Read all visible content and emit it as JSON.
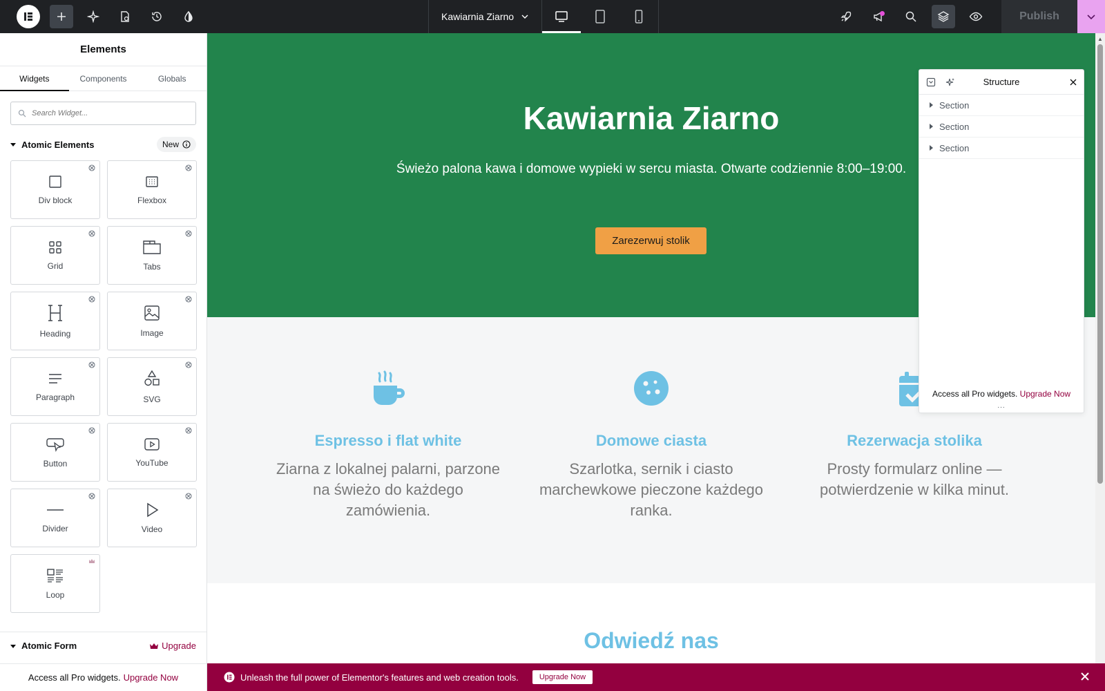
{
  "topbar": {
    "document_title": "Kawiarnia Ziarno",
    "publish_label": "Publish",
    "left_buttons": [
      "elementor-logo-icon",
      "add-element-icon",
      "site-settings-icon",
      "page-settings-icon",
      "history-icon",
      "theme-style-icon"
    ],
    "right_buttons": [
      "launch-icon",
      "whats-new-icon",
      "finder-icon",
      "structure-icon",
      "preview-icon"
    ]
  },
  "panel": {
    "title": "Elements",
    "tabs": [
      "Widgets",
      "Components",
      "Globals"
    ],
    "search_placeholder": "Search Widget...",
    "category": {
      "name": "Atomic Elements",
      "badge": "New"
    },
    "widgets": [
      {
        "label": "Div block",
        "icon": "div-block-icon"
      },
      {
        "label": "Flexbox",
        "icon": "flexbox-icon"
      },
      {
        "label": "Grid",
        "icon": "grid-icon"
      },
      {
        "label": "Tabs",
        "icon": "tabs-icon"
      },
      {
        "label": "Heading",
        "icon": "heading-icon"
      },
      {
        "label": "Image",
        "icon": "image-icon"
      },
      {
        "label": "Paragraph",
        "icon": "paragraph-icon"
      },
      {
        "label": "SVG",
        "icon": "svg-icon"
      },
      {
        "label": "Button",
        "icon": "button-icon"
      },
      {
        "label": "YouTube",
        "icon": "youtube-icon"
      },
      {
        "label": "Divider",
        "icon": "divider-icon"
      },
      {
        "label": "Video",
        "icon": "video-icon"
      },
      {
        "label": "Loop",
        "icon": "loop-icon"
      }
    ],
    "form_category": {
      "name": "Atomic Form",
      "upgrade": "Upgrade"
    },
    "footer": {
      "text": "Access all Pro widgets.",
      "link": "Upgrade Now"
    }
  },
  "canvas": {
    "hero": {
      "title": "Kawiarnia Ziarno",
      "subtitle": "Świeżo palona kawa i domowe wypieki w sercu miasta. Otwarte codziennie 8:00–19:00.",
      "button": "Zarezerwuj stolik"
    },
    "features": [
      {
        "icon": "coffee-cup-icon",
        "title": "Espresso i flat white",
        "text": "Ziarna z lokalnej palarni, parzone na świeżo do każdego zamówienia."
      },
      {
        "icon": "cookie-icon",
        "title": "Domowe ciasta",
        "text": "Szarlotka, sernik i ciasto marchewkowe pieczone każdego ranka."
      },
      {
        "icon": "calendar-check-icon",
        "title": "Rezerwacja stolika",
        "text": "Prosty formularz online — potwierdzenie w kilka minut."
      }
    ],
    "visit_title": "Odwiedź nas"
  },
  "structure": {
    "title": "Structure",
    "items": [
      "Section",
      "Section",
      "Section"
    ],
    "footer_text": "Access all Pro widgets.",
    "footer_link": "Upgrade Now",
    "more": "..."
  },
  "banner": {
    "text": "Unleash the full power of Elementor's features and web creation tools.",
    "button": "Upgrade Now"
  },
  "colors": {
    "topbar": "#1f2124",
    "hero": "#22844c",
    "accent": "#6ec1e4",
    "cta": "#f0a045",
    "pro": "#93003f",
    "publish_toggle": "#e9a3f0"
  }
}
